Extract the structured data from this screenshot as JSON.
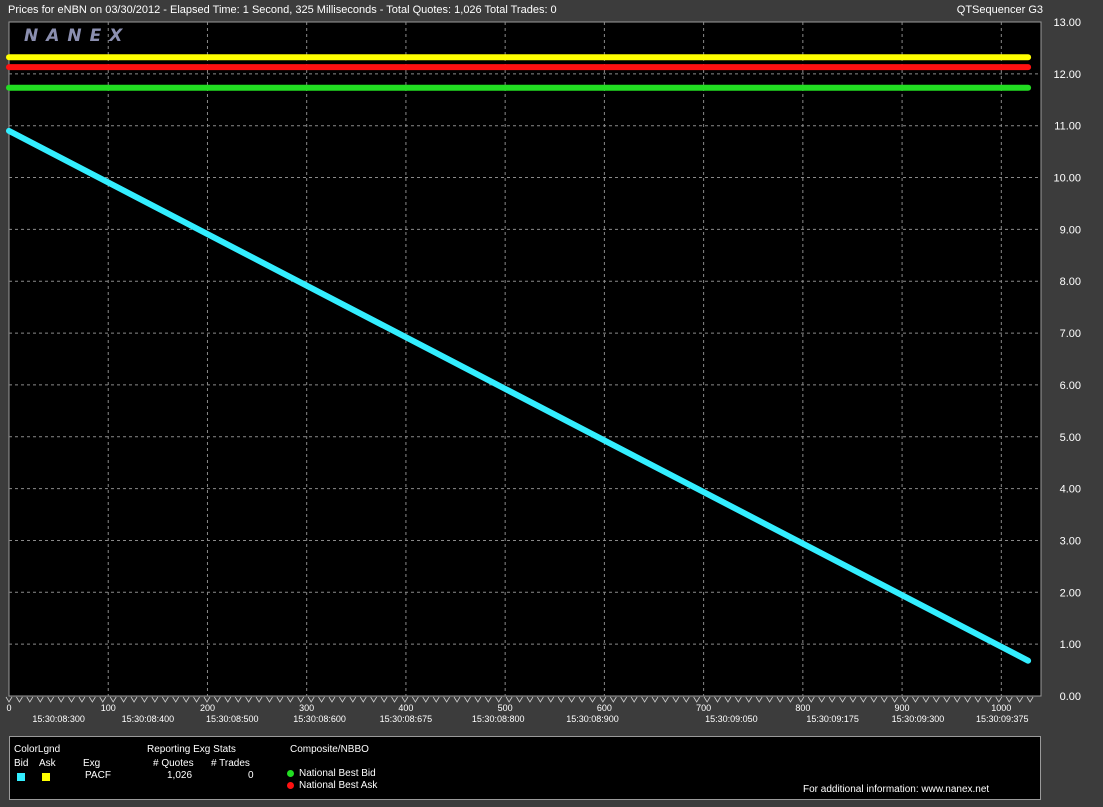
{
  "header": {
    "title": "Prices for  eNBN  on  03/30/2012  -  Elapsed Time: 1 Second, 325 Milliseconds  -  Total Quotes: 1,026  Total Trades: 0",
    "app": "QTSequencer G3"
  },
  "logo": "NANEX",
  "colors": {
    "background": "#000000",
    "frame": "#3c3c3c",
    "grid": "#8a8a8a",
    "bid": "#33eeff",
    "ask": "#ffff00",
    "nbb": "#22dd22",
    "nba": "#ff1111"
  },
  "chart_data": {
    "type": "line",
    "xlim": [
      0,
      1040
    ],
    "ylim": [
      0,
      13
    ],
    "grid": true,
    "yticks": [
      "0.00",
      "1.00",
      "2.00",
      "3.00",
      "4.00",
      "5.00",
      "6.00",
      "7.00",
      "8.00",
      "9.00",
      "10.00",
      "11.00",
      "12.00",
      "13.00"
    ],
    "xticks": [
      {
        "v": 0,
        "label": "0"
      },
      {
        "v": 100,
        "label": "100"
      },
      {
        "v": 200,
        "label": "200"
      },
      {
        "v": 300,
        "label": "300"
      },
      {
        "v": 400,
        "label": "400"
      },
      {
        "v": 500,
        "label": "500"
      },
      {
        "v": 600,
        "label": "600"
      },
      {
        "v": 700,
        "label": "700"
      },
      {
        "v": 800,
        "label": "800"
      },
      {
        "v": 900,
        "label": "900"
      },
      {
        "v": 1000,
        "label": "1000"
      }
    ],
    "time_labels": [
      {
        "v": 50,
        "label": "15:30:08:300"
      },
      {
        "v": 140,
        "label": "15:30:08:400"
      },
      {
        "v": 225,
        "label": "15:30:08:500"
      },
      {
        "v": 313,
        "label": "15:30:08:600"
      },
      {
        "v": 400,
        "label": "15:30:08:675"
      },
      {
        "v": 493,
        "label": "15:30:08:800"
      },
      {
        "v": 588,
        "label": "15:30:08:900"
      },
      {
        "v": 728,
        "label": "15:30:09:050"
      },
      {
        "v": 830,
        "label": "15:30:09:175"
      },
      {
        "v": 916,
        "label": "15:30:09:300"
      },
      {
        "v": 1001,
        "label": "15:30:09:375"
      }
    ],
    "series": [
      {
        "name": "Bid",
        "color": "#33eeff",
        "x": [
          0,
          1027
        ],
        "y": [
          10.9,
          0.68
        ]
      },
      {
        "name": "Ask",
        "color": "#ffff00",
        "x": [
          0,
          1027
        ],
        "y": [
          12.32,
          12.32
        ]
      },
      {
        "name": "National Best Ask",
        "color": "#ff1111",
        "x": [
          0,
          1027
        ],
        "y": [
          12.13,
          12.13
        ]
      },
      {
        "name": "National Best Bid",
        "color": "#22dd22",
        "x": [
          0,
          1027
        ],
        "y": [
          11.73,
          11.73
        ]
      }
    ]
  },
  "legend": {
    "colorlgnd": "ColorLgnd",
    "bid": "Bid",
    "ask": "Ask",
    "exg_header": "Exg",
    "exg": "PACF",
    "stats_title": "Reporting Exg Stats",
    "quotes_header": "# Quotes",
    "trades_header": "# Trades",
    "quotes": "1,026",
    "trades": "0",
    "composite": "Composite/NBBO",
    "nbb": "National Best Bid",
    "nba": "National Best Ask",
    "info": "For additional information: www.nanex.net"
  }
}
